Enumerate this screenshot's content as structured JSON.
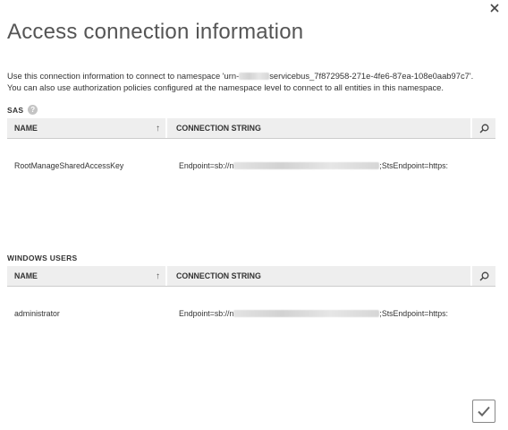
{
  "dialog": {
    "title": "Access connection information",
    "close_icon": "close-icon",
    "description_line1_prefix": "Use this connection information to connect to namespace 'urn-",
    "description_line1_suffix": "servicebus_7f872958-271e-4fe6-87ea-108e0aab97c7'.",
    "description_line2": "You can also use authorization policies configured at the namespace level to connect to all entities in this namespace."
  },
  "sas": {
    "label": "SAS",
    "help_icon": "help-icon",
    "headers": {
      "name": "NAME",
      "connection": "CONNECTION STRING"
    },
    "sort_icon": "sort-ascending-icon",
    "search_icon": "search-icon",
    "rows": [
      {
        "name": "RootManageSharedAccessKey",
        "conn_prefix": "Endpoint=sb://n",
        "conn_suffix": ";StsEndpoint=https:"
      }
    ]
  },
  "windows_users": {
    "label": "WINDOWS USERS",
    "headers": {
      "name": "NAME",
      "connection": "CONNECTION STRING"
    },
    "sort_icon": "sort-ascending-icon",
    "search_icon": "search-icon",
    "rows": [
      {
        "name": "administrator",
        "conn_prefix": "Endpoint=sb://n",
        "conn_suffix": ";StsEndpoint=https:"
      }
    ]
  },
  "footer": {
    "confirm_icon": "checkmark-icon"
  },
  "colors": {
    "header_bg": "#eeeeee",
    "text": "#333333",
    "title": "#555555"
  }
}
